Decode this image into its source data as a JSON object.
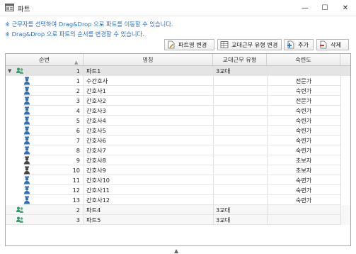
{
  "window": {
    "title": "파트",
    "min_symbol": "—",
    "max_symbol": "☐",
    "close_symbol": "✕"
  },
  "notices": [
    "※ 근무자를 선택하여 Drag&Drop 으로 파트를 이동할 수 있습니다.",
    "※ Drag&Drop 으로 파트의 순서를 변경할 수 있습니다."
  ],
  "toolbar": {
    "rename_label": "파트명 변경",
    "shift_type_label": "교대근무 유형 변경",
    "add_label": "추가",
    "delete_label": "삭제"
  },
  "table": {
    "columns": {
      "seq": "순번",
      "name": "명칭",
      "shift": "교대근무 유형",
      "skill": "숙련도"
    },
    "sort_indicator": "▲",
    "rows": [
      {
        "kind": "group",
        "expanded": true,
        "seq": "1",
        "name": "파트1",
        "shift": "3교대",
        "skill": "",
        "icon": "group-icon"
      },
      {
        "kind": "member",
        "seq": "1",
        "name": "수간호사",
        "shift": "",
        "skill": "전문가",
        "icon": "nurse-blue-icon"
      },
      {
        "kind": "member",
        "seq": "2",
        "name": "간호사1",
        "shift": "",
        "skill": "숙련가",
        "icon": "nurse-blue-icon"
      },
      {
        "kind": "member",
        "seq": "3",
        "name": "간호사2",
        "shift": "",
        "skill": "전문가",
        "icon": "nurse-blue-icon"
      },
      {
        "kind": "member",
        "seq": "4",
        "name": "간호사3",
        "shift": "",
        "skill": "숙련가",
        "icon": "nurse-blue-icon"
      },
      {
        "kind": "member",
        "seq": "5",
        "name": "간호사4",
        "shift": "",
        "skill": "숙련가",
        "icon": "nurse-blue-icon"
      },
      {
        "kind": "member",
        "seq": "6",
        "name": "간호사5",
        "shift": "",
        "skill": "숙련가",
        "icon": "nurse-blue-icon"
      },
      {
        "kind": "member",
        "seq": "7",
        "name": "간호사6",
        "shift": "",
        "skill": "숙련가",
        "icon": "nurse-blue-icon"
      },
      {
        "kind": "member",
        "seq": "8",
        "name": "간호사7",
        "shift": "",
        "skill": "숙련가",
        "icon": "nurse-blue-icon"
      },
      {
        "kind": "member",
        "seq": "9",
        "name": "간호사8",
        "shift": "",
        "skill": "초보자",
        "icon": "nurse-dark-icon"
      },
      {
        "kind": "member",
        "seq": "10",
        "name": "간호사9",
        "shift": "",
        "skill": "초보자",
        "icon": "nurse-dark-icon"
      },
      {
        "kind": "member",
        "seq": "11",
        "name": "간호사10",
        "shift": "",
        "skill": "숙련가",
        "icon": "nurse-blue-icon"
      },
      {
        "kind": "member",
        "seq": "12",
        "name": "간호사11",
        "shift": "",
        "skill": "숙련가",
        "icon": "nurse-blue-icon"
      },
      {
        "kind": "member",
        "seq": "13",
        "name": "간호사12",
        "shift": "",
        "skill": "숙련가",
        "icon": "nurse-blue-icon"
      },
      {
        "kind": "group",
        "expanded": false,
        "seq": "2",
        "name": "파트4",
        "shift": "3교대",
        "skill": "",
        "icon": "group-icon"
      },
      {
        "kind": "group",
        "expanded": false,
        "seq": "3",
        "name": "파트5",
        "shift": "3교대",
        "skill": "",
        "icon": "group-icon"
      }
    ]
  },
  "colors": {
    "notice": "#2a6ec6",
    "group_icon": "#3a9a6a",
    "nurse_blue": "#2f6fb6",
    "nurse_dark": "#444444"
  },
  "footer": {
    "scroll_glyph": "▲"
  }
}
